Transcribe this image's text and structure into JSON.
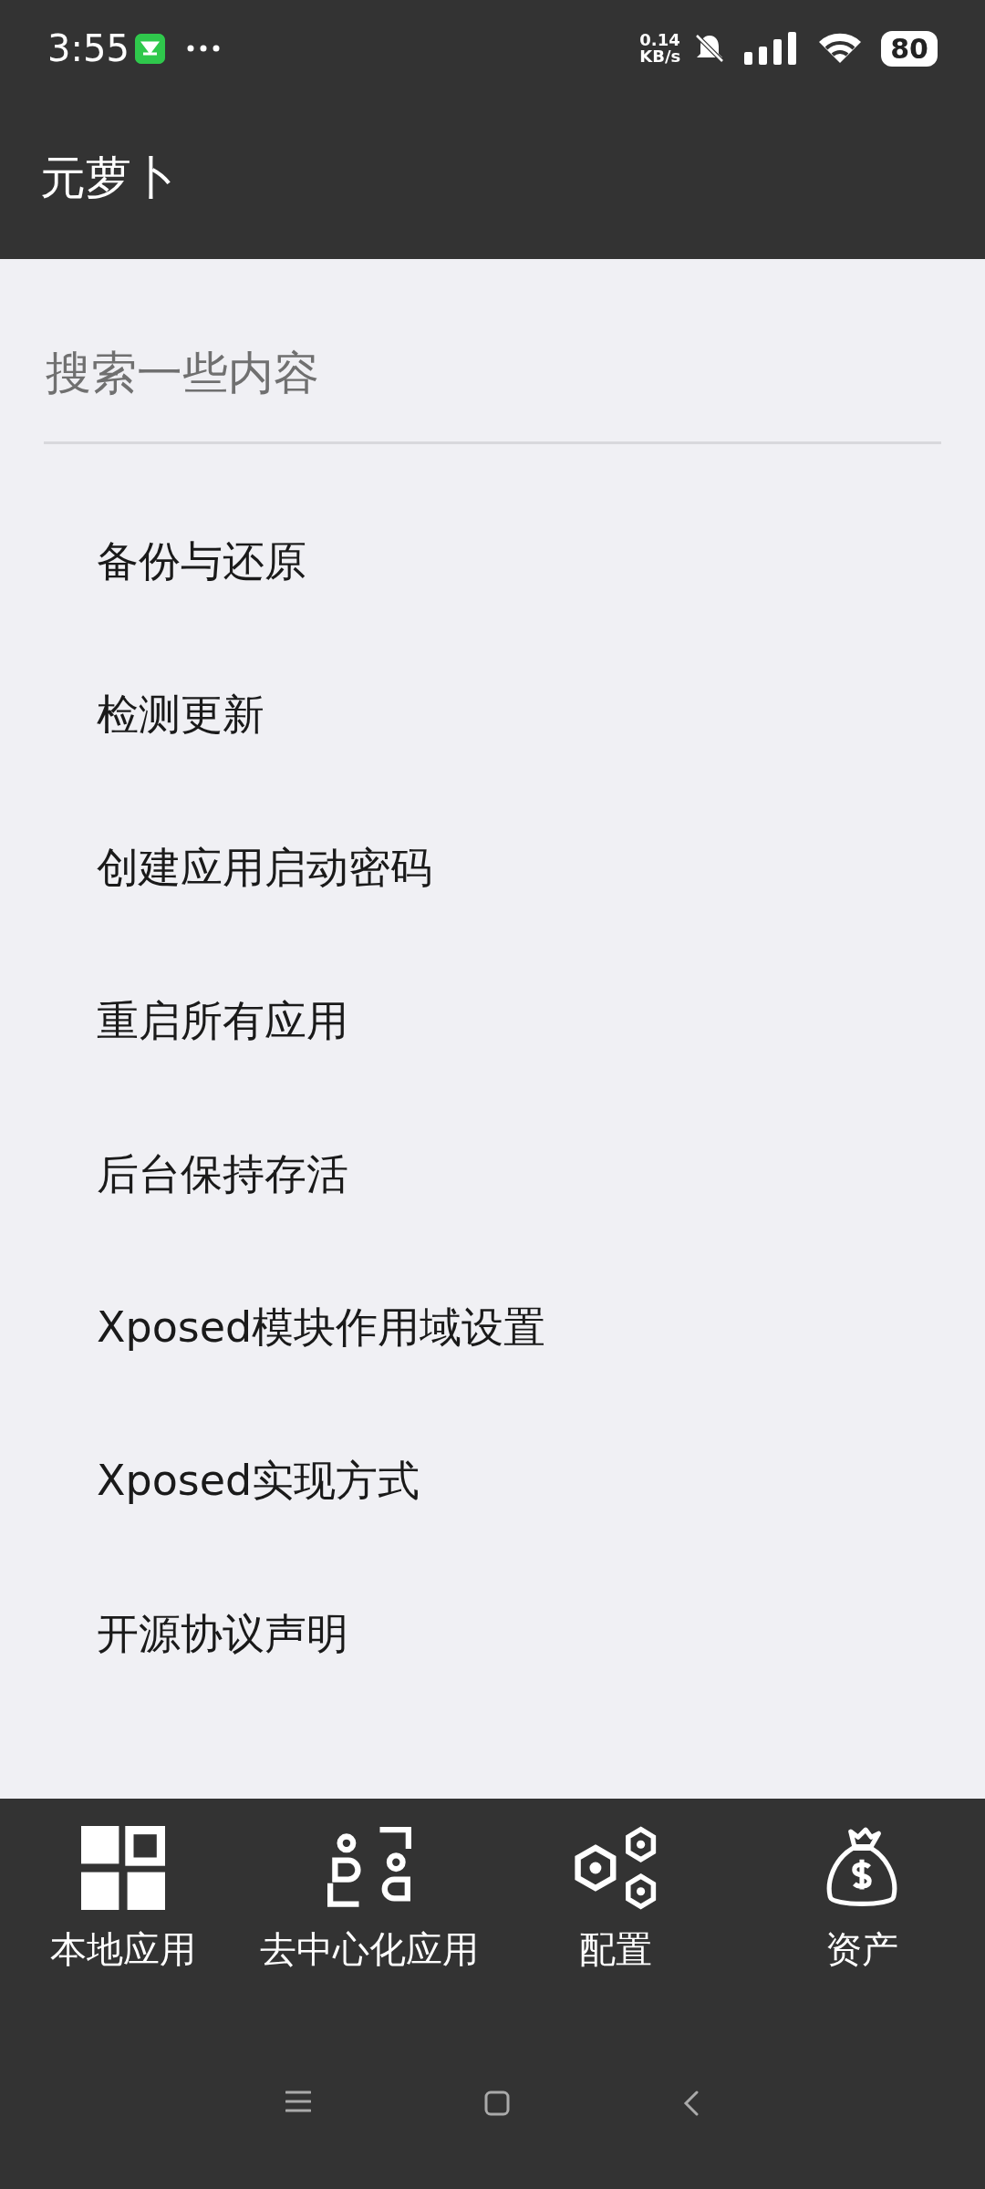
{
  "status_bar": {
    "time": "3:55",
    "speed_value": "0.14",
    "speed_unit": "KB/s",
    "battery": "80"
  },
  "app_bar": {
    "title": "元萝卜"
  },
  "search": {
    "placeholder": "搜索一些内容"
  },
  "menu_items": [
    {
      "label": "备份与还原"
    },
    {
      "label": "检测更新"
    },
    {
      "label": "创建应用启动密码"
    },
    {
      "label": "重启所有应用"
    },
    {
      "label": "后台保持存活"
    },
    {
      "label": "Xposed模块作用域设置"
    },
    {
      "label": "Xposed实现方式"
    },
    {
      "label": "开源协议声明"
    }
  ],
  "bottom_nav": [
    {
      "kind": "grid",
      "label": "本地应用"
    },
    {
      "kind": "people",
      "label": "去中心化应用"
    },
    {
      "kind": "hexagons",
      "label": "配置"
    },
    {
      "kind": "moneybag",
      "label": "资产"
    }
  ]
}
